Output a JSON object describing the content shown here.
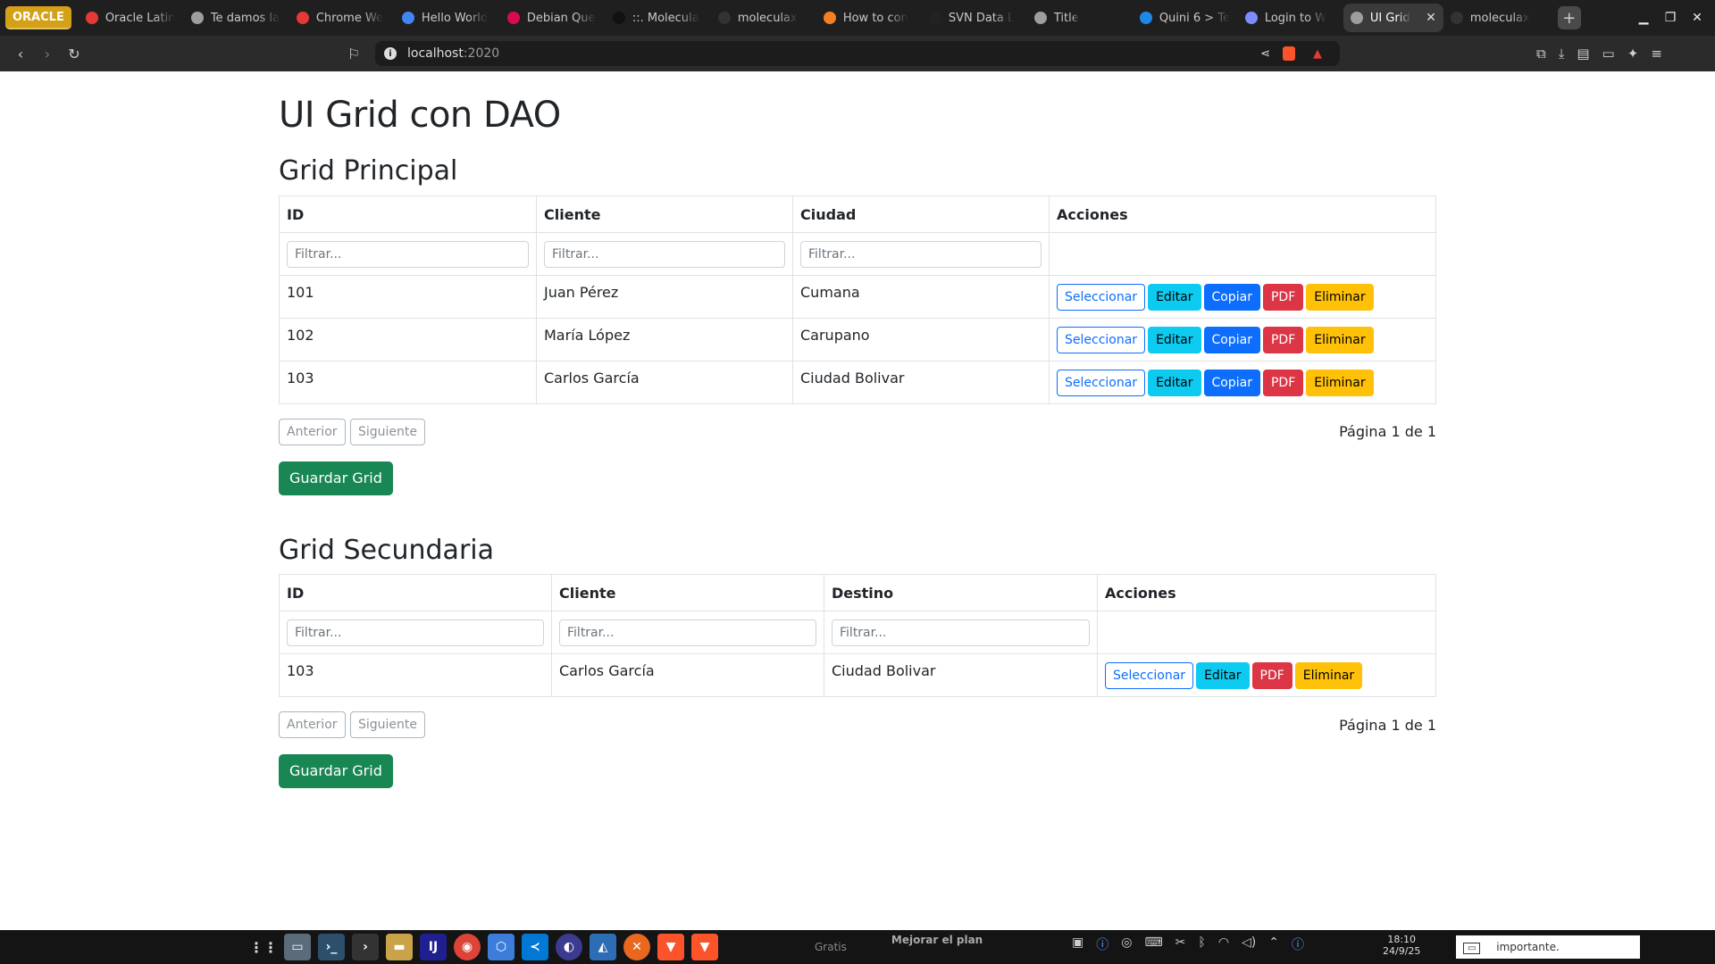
{
  "browser": {
    "tabs": [
      {
        "label": "ORACLE",
        "kind": "pill"
      },
      {
        "label": "Oracle Latin",
        "icon": "oracle-ring-icon",
        "color": "#e53935"
      },
      {
        "label": "Te damos la",
        "icon": "globe-icon",
        "color": "#9e9e9e"
      },
      {
        "label": "Chrome We",
        "icon": "image-icon",
        "color": "#e53935"
      },
      {
        "label": "Hello World",
        "icon": "kotlin-icon",
        "color": "#4285f4"
      },
      {
        "label": "Debian Que",
        "icon": "debian-icon",
        "color": "#d70a53"
      },
      {
        "label": "::. Molecula",
        "icon": "molecule-icon",
        "color": "#111111"
      },
      {
        "label": "moleculax",
        "icon": "blank-icon",
        "color": "#333333"
      },
      {
        "label": "How to con",
        "icon": "stackoverflow-icon",
        "color": "#f48024"
      },
      {
        "label": "SVN Data L",
        "icon": "github-icon",
        "color": "#222222"
      },
      {
        "label": "Title",
        "icon": "globe-icon",
        "color": "#9e9e9e"
      },
      {
        "label": "Quini 6 > Te",
        "icon": "ball-icon",
        "color": "#1e88e5"
      },
      {
        "label": "Login to W",
        "icon": "link-icon",
        "color": "#7c8cff"
      },
      {
        "label": "UI Grid",
        "icon": "globe-icon",
        "color": "#9e9e9e",
        "active": true
      },
      {
        "label": "moleculax",
        "icon": "blank-icon",
        "color": "#333333"
      }
    ],
    "url_host": "localhost",
    "url_port": ":2020"
  },
  "page": {
    "title": "UI Grid con DAO",
    "primary": {
      "heading": "Grid Principal",
      "columns": [
        "ID",
        "Cliente",
        "Ciudad",
        "Acciones"
      ],
      "filter_placeholder": "Filtrar...",
      "rows": [
        {
          "id": "101",
          "cliente": "Juan Pérez",
          "ciudad": "Cumana"
        },
        {
          "id": "102",
          "cliente": "María López",
          "ciudad": "Carupano"
        },
        {
          "id": "103",
          "cliente": "Carlos García",
          "ciudad": "Ciudad Bolivar"
        }
      ],
      "actions": [
        "Seleccionar",
        "Editar",
        "Copiar",
        "PDF",
        "Eliminar"
      ],
      "prev_label": "Anterior",
      "next_label": "Siguiente",
      "page_info": "Página 1 de 1",
      "save_label": "Guardar Grid"
    },
    "secondary": {
      "heading": "Grid Secundaria",
      "columns": [
        "ID",
        "Cliente",
        "Destino",
        "Acciones"
      ],
      "filter_placeholder": "Filtrar...",
      "rows": [
        {
          "id": "103",
          "cliente": "Carlos García",
          "destino": "Ciudad Bolivar"
        }
      ],
      "actions": [
        "Seleccionar",
        "Editar",
        "PDF",
        "Eliminar"
      ],
      "prev_label": "Anterior",
      "next_label": "Siguiente",
      "page_info": "Página 1 de 1",
      "save_label": "Guardar Grid"
    }
  },
  "taskbar": {
    "clock_time": "18:10",
    "clock_date": "24/9/25",
    "tray_text": "Gratis",
    "tray_text2": "Mejorar el plan",
    "notification": "importante."
  },
  "colors": {
    "primary": "#0d6efd",
    "info": "#0dcaf0",
    "danger": "#dc3545",
    "warning": "#ffc107",
    "success": "#198754"
  }
}
